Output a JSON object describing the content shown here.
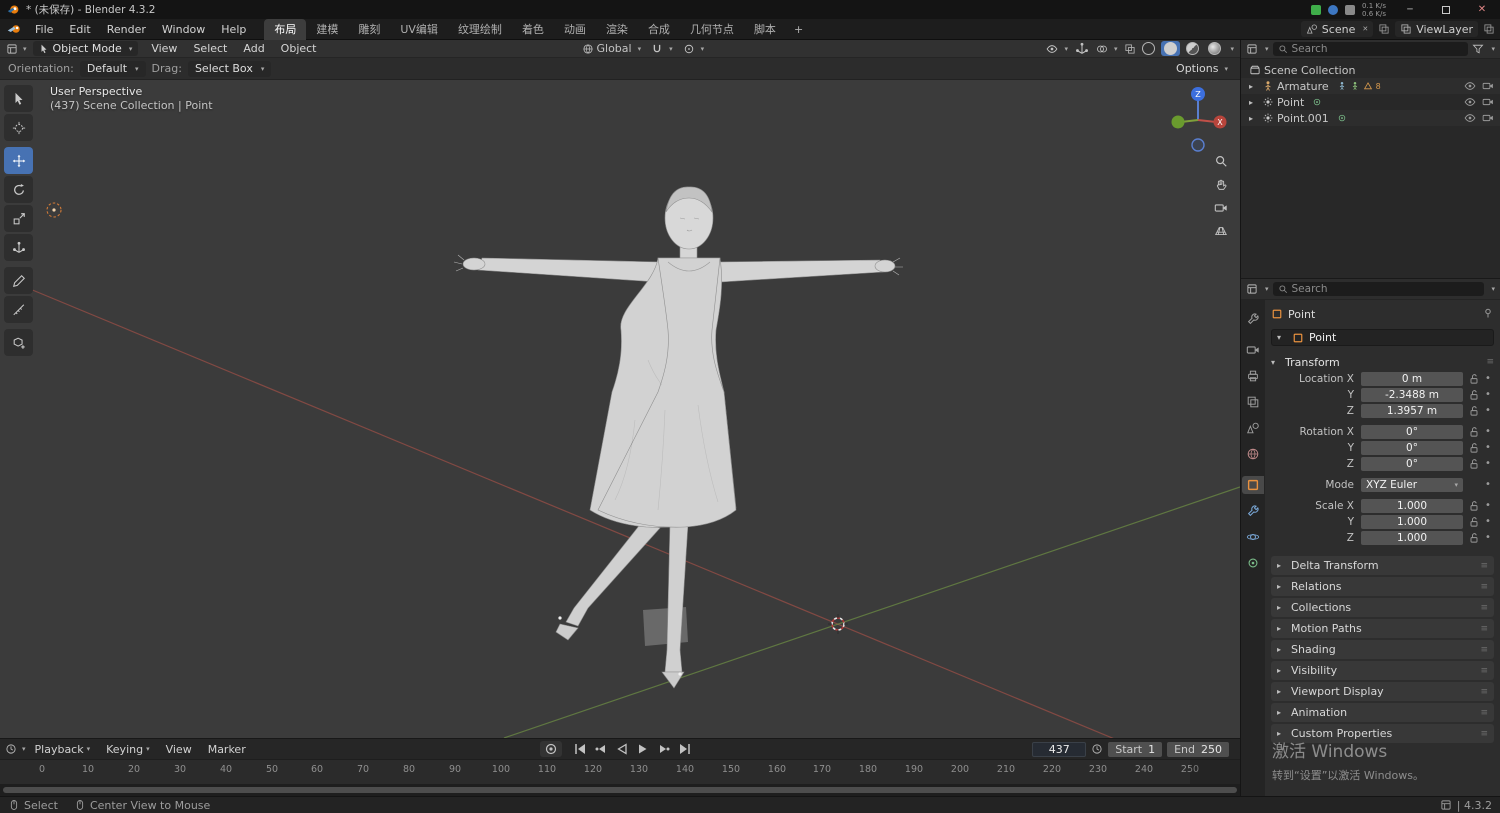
{
  "title_bar": {
    "title": "* (未保存) - Blender 4.3.2",
    "net_up": "0.1 K/s",
    "net_down": "0.6 K/s"
  },
  "topbar": {
    "menus": [
      "File",
      "Edit",
      "Render",
      "Window",
      "Help"
    ],
    "workspaces": [
      "布局",
      "建模",
      "雕刻",
      "UV编辑",
      "纹理绘制",
      "着色",
      "动画",
      "渲染",
      "合成",
      "几何节点",
      "脚本"
    ],
    "new_workspace": "+",
    "scene": "Scene",
    "view_layer": "ViewLayer"
  },
  "viewport_header": {
    "mode": "Object Mode",
    "menus": [
      "View",
      "Select",
      "Add",
      "Object"
    ],
    "orientation": "Global"
  },
  "tool_settings": {
    "orientation_label": "Orientation:",
    "orientation_value": "Default",
    "drag_label": "Drag:",
    "drag_value": "Select Box",
    "options": "Options"
  },
  "viewport": {
    "overlay_line1": "User Perspective",
    "overlay_line2": "(437) Scene Collection | Point",
    "gizmo_z": "Z",
    "gizmo_x": "X"
  },
  "toolbar": {
    "tools": [
      "tweak-select",
      "cursor",
      "move",
      "rotate",
      "scale",
      "transform",
      "annotate",
      "measure",
      "add-cube"
    ],
    "active_tool": "move"
  },
  "outliner": {
    "search_placeholder": "Search",
    "items": [
      {
        "name": "Scene Collection"
      },
      {
        "name": "Armature",
        "badge": "8"
      },
      {
        "name": "Point"
      },
      {
        "name": "Point.001"
      }
    ]
  },
  "properties": {
    "search_placeholder": "Search",
    "tabs": [
      "tool",
      "render",
      "output",
      "view-layer",
      "scene",
      "world",
      "object",
      "modifiers",
      "physics",
      "object-data"
    ],
    "active_tab": "object",
    "breadcrumb": "Point",
    "object_name": "Point",
    "transform_title": "Transform",
    "rows": [
      {
        "label": "Location X",
        "value": "0 m"
      },
      {
        "label": "Y",
        "value": "-2.3488 m"
      },
      {
        "label": "Z",
        "value": "1.3957 m"
      },
      {
        "label": "Rotation X",
        "value": "0°"
      },
      {
        "label": "Y",
        "value": "0°"
      },
      {
        "label": "Z",
        "value": "0°"
      },
      {
        "label": "Mode",
        "value": "XYZ Euler"
      },
      {
        "label": "Scale X",
        "value": "1.000"
      },
      {
        "label": "Y",
        "value": "1.000"
      },
      {
        "label": "Z",
        "value": "1.000"
      }
    ],
    "sections": [
      "Delta Transform",
      "Relations",
      "Collections",
      "Motion Paths",
      "Shading",
      "Visibility",
      "Viewport Display",
      "Animation",
      "Custom Properties"
    ]
  },
  "timeline": {
    "menus": [
      "Playback",
      "Keying",
      "View",
      "Marker"
    ],
    "current_frame": "437",
    "start_label": "Start",
    "start_value": "1",
    "end_label": "End",
    "end_value": "250",
    "ticks": [
      "0",
      "10",
      "20",
      "30",
      "40",
      "50",
      "60",
      "70",
      "80",
      "90",
      "100",
      "110",
      "120",
      "130",
      "140",
      "150",
      "160",
      "170",
      "180",
      "190",
      "200",
      "210",
      "220",
      "230",
      "240",
      "250"
    ]
  },
  "status_bar": {
    "select": "Select",
    "center_view": "Center View to Mouse",
    "version": "| 4.3.2"
  },
  "watermark": {
    "line1": "激活 Windows",
    "line2": "转到“设置”以激活 Windows。"
  },
  "colors": {
    "accent_blue": "#4772b3",
    "object_orange": "#e8913f",
    "axis_red": "#b84a3f",
    "axis_green": "#6a9b2e",
    "axis_blue": "#3c6fde"
  }
}
